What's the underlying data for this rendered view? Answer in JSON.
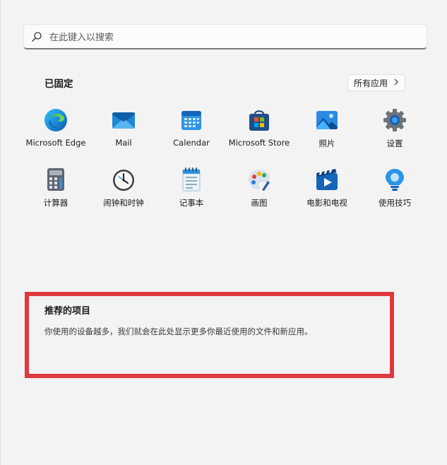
{
  "search": {
    "placeholder": "在此键入以搜索"
  },
  "pinned": {
    "title": "已固定",
    "all_apps_label": "所有应用",
    "apps": [
      {
        "label": "Microsoft Edge"
      },
      {
        "label": "Mail"
      },
      {
        "label": "Calendar"
      },
      {
        "label": "Microsoft Store"
      },
      {
        "label": "照片"
      },
      {
        "label": "设置"
      },
      {
        "label": "计算器"
      },
      {
        "label": "闹钟和时钟"
      },
      {
        "label": "记事本"
      },
      {
        "label": "画图"
      },
      {
        "label": "电影和电视"
      },
      {
        "label": "使用技巧"
      }
    ]
  },
  "recommended": {
    "title": "推荐的项目",
    "description": "你使用的设备越多，我们就会在此处显示更多你最近使用的文件和新应用。"
  },
  "colors": {
    "highlight_border": "#e0383d",
    "background": "#f3f3f3"
  }
}
